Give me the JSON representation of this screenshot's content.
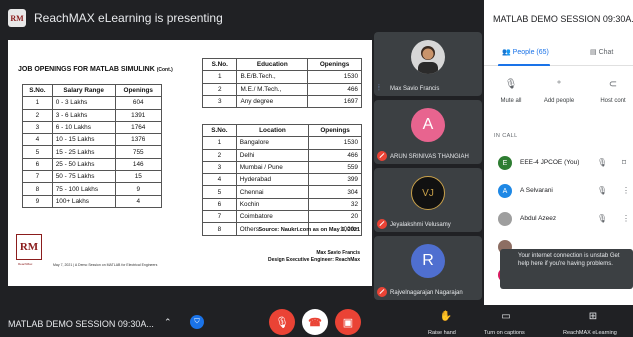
{
  "top_bar": {
    "presenter_text": "ReachMAX eLearning is presenting"
  },
  "slide": {
    "title": "JOB OPENINGS FOR MATLAB SIMULINK",
    "title_suffix": "(Cont.)",
    "salary_table": {
      "headers": [
        "S.No.",
        "Salary Range",
        "Openings"
      ],
      "rows": [
        [
          "1",
          "0 - 3 Lakhs",
          "604"
        ],
        [
          "2",
          "3 - 6 Lakhs",
          "1391"
        ],
        [
          "3",
          "6 - 10 Lakhs",
          "1764"
        ],
        [
          "4",
          "10 - 15 Lakhs",
          "1376"
        ],
        [
          "5",
          "15 - 25 Lakhs",
          "755"
        ],
        [
          "6",
          "25 - 50 Lakhs",
          "146"
        ],
        [
          "7",
          "50 - 75 Lakhs",
          "15"
        ],
        [
          "8",
          "75 - 100 Lakhs",
          "9"
        ],
        [
          "9",
          "100+ Lakhs",
          "4"
        ]
      ]
    },
    "education_table": {
      "headers": [
        "S.No.",
        "Education",
        "Openings"
      ],
      "rows": [
        [
          "1",
          "B.E/B.Tech.,",
          "1530"
        ],
        [
          "2",
          "M.E./ M.Tech.,",
          "466"
        ],
        [
          "3",
          "Any degree",
          "1697"
        ]
      ]
    },
    "location_table": {
      "headers": [
        "S.No.",
        "Location",
        "Openings"
      ],
      "rows": [
        [
          "1",
          "Bangalore",
          "1530"
        ],
        [
          "2",
          "Delhi",
          "466"
        ],
        [
          "3",
          "Mumbai / Pune",
          "559"
        ],
        [
          "4",
          "Hyderabad",
          "399"
        ],
        [
          "5",
          "Chennai",
          "304"
        ],
        [
          "6",
          "Kochin",
          "32"
        ],
        [
          "7",
          "Coimbatore",
          "20"
        ],
        [
          "8",
          "Others",
          "1000+"
        ]
      ]
    },
    "source": "Source: Naukri.com as on May 6, 2021",
    "footer": "May 7, 2021 | A Demo Session on MATLAB for Electrical Engineers",
    "presenter_name": "Max Savio Francis",
    "presenter_role": "Design Executive Engineer: ReachMax",
    "logo_text": "RM",
    "logo_sub": "ReachMax"
  },
  "tiles": [
    {
      "name": "Max Savio Francis",
      "avatar_letter": "",
      "avatar_color": "#e0e0e0",
      "status": "speaking"
    },
    {
      "name": "ARUN SRINIVAS THANGIAH",
      "avatar_letter": "A",
      "avatar_color": "#e8648f",
      "status": "muted"
    },
    {
      "name": "Jeyalakshmi Velusamy",
      "avatar_letter": "VJ",
      "avatar_color": "#111111",
      "status": "muted"
    },
    {
      "name": "Rajvelnagarajan Nagarajan",
      "avatar_letter": "R",
      "avatar_color": "#4f6fd0",
      "status": "muted"
    }
  ],
  "panel": {
    "title": "MATLAB DEMO SESSION 09:30A...",
    "tab_people": "People (65)",
    "tab_chat": "Chat",
    "actions": [
      "Mute all",
      "Add people",
      "Host cont"
    ],
    "in_call_label": "IN CALL",
    "participants": [
      {
        "letter": "E",
        "name": "EEE-4 JPCOE (You)",
        "color": "#2e7d32"
      },
      {
        "letter": "A",
        "name": "A Selvarani",
        "color": "#1e88e5"
      },
      {
        "letter": "",
        "name": "Abdul Azeez",
        "color": "#9e9e9e"
      },
      {
        "letter": "",
        "name": "",
        "color": "#8d6e63"
      },
      {
        "letter": "A",
        "name": "",
        "color": "#d81b60"
      }
    ]
  },
  "toast": {
    "text": "Your internet connection is unstab Get help here if you're having problems."
  },
  "bottom_bar": {
    "meeting_name": "MATLAB DEMO SESSION 09:30A...",
    "raise_hand": "Raise hand",
    "captions": "Turn on captions",
    "presenting": "ReachMAX eLearning"
  },
  "colors": {
    "accent": "#1a73e8",
    "danger": "#ea4335",
    "dark_bg": "#202124"
  }
}
